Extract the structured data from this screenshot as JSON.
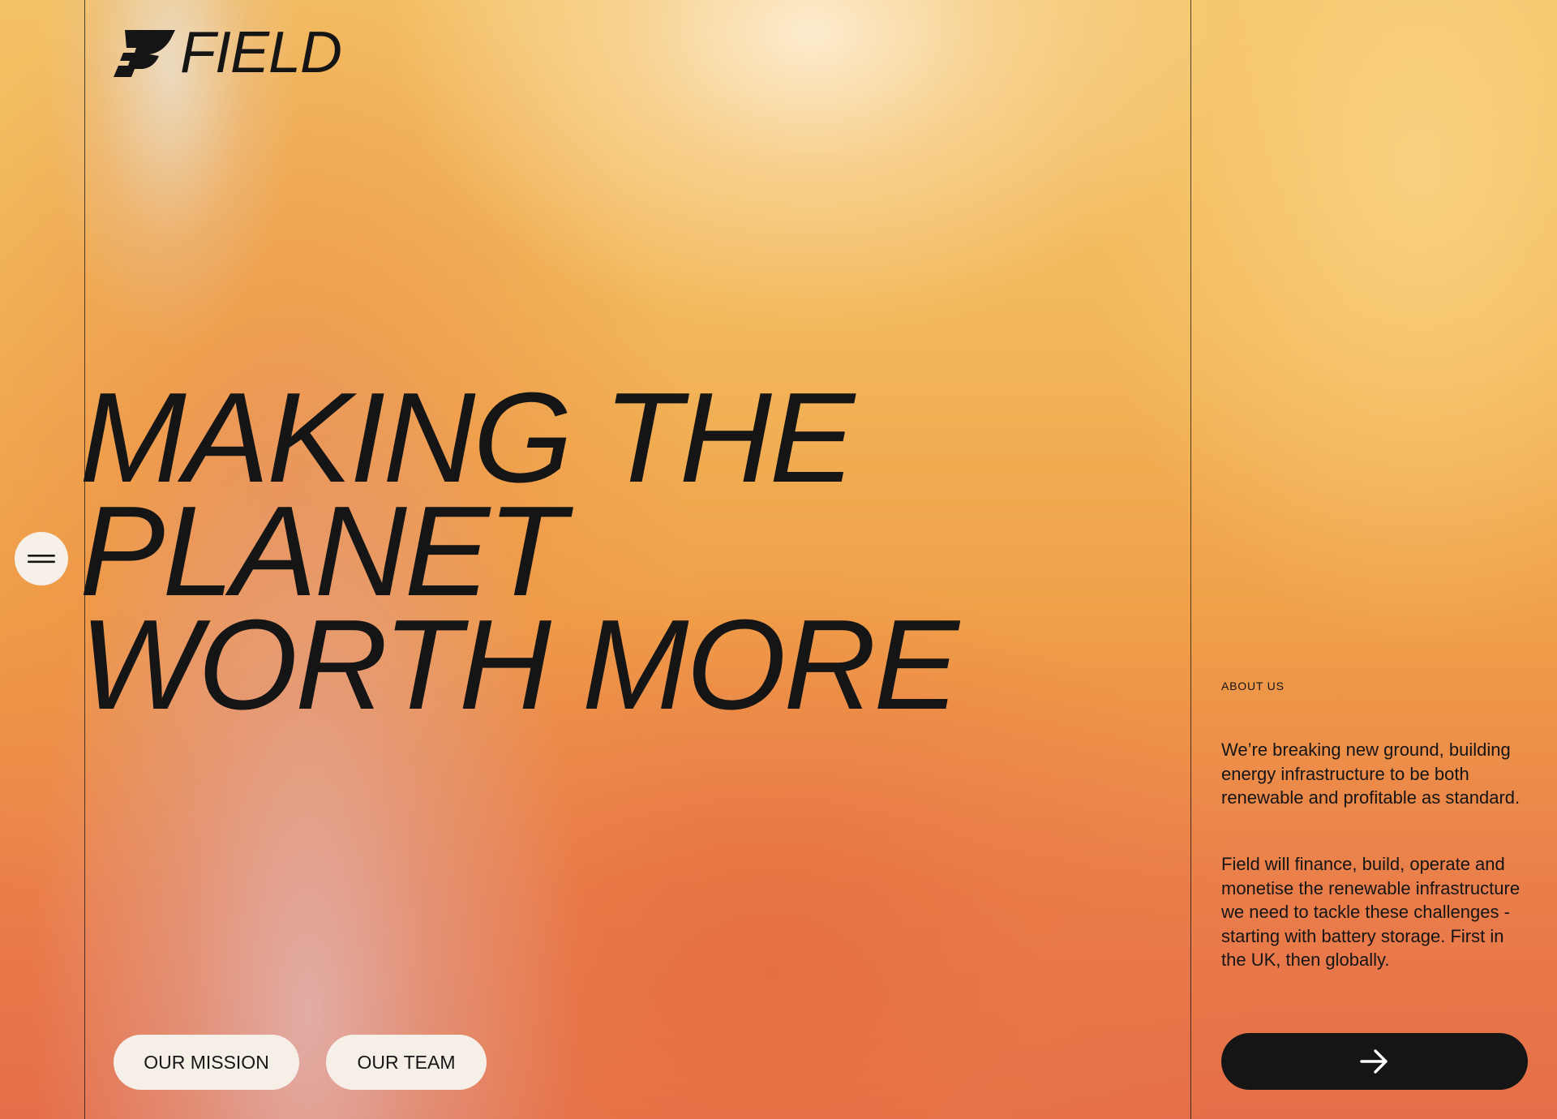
{
  "brand": {
    "name": "FIELD"
  },
  "navigation": {
    "menu_icon": "hamburger-menu-icon"
  },
  "hero": {
    "headline_lines": [
      "MAKING THE",
      "PLANET",
      "WORTH MORE"
    ]
  },
  "actions": {
    "mission_label": "OUR MISSION",
    "team_label": "OUR TEAM",
    "next_icon": "arrow-right-icon"
  },
  "about": {
    "label": "ABOUT US",
    "paragraph_1": "We’re breaking new ground, building energy infrastructure to be both renewable and profitable as standard.",
    "paragraph_2": "Field will finance, build, operate and monetise the renewable infrastructure we need to tackle these challenges - starting with battery storage. First in the UK, then globally."
  },
  "colors": {
    "ink": "#151515",
    "pill_background": "#f5efe7",
    "gradient_top": "#f3c265",
    "gradient_bottom": "#e56e48"
  }
}
